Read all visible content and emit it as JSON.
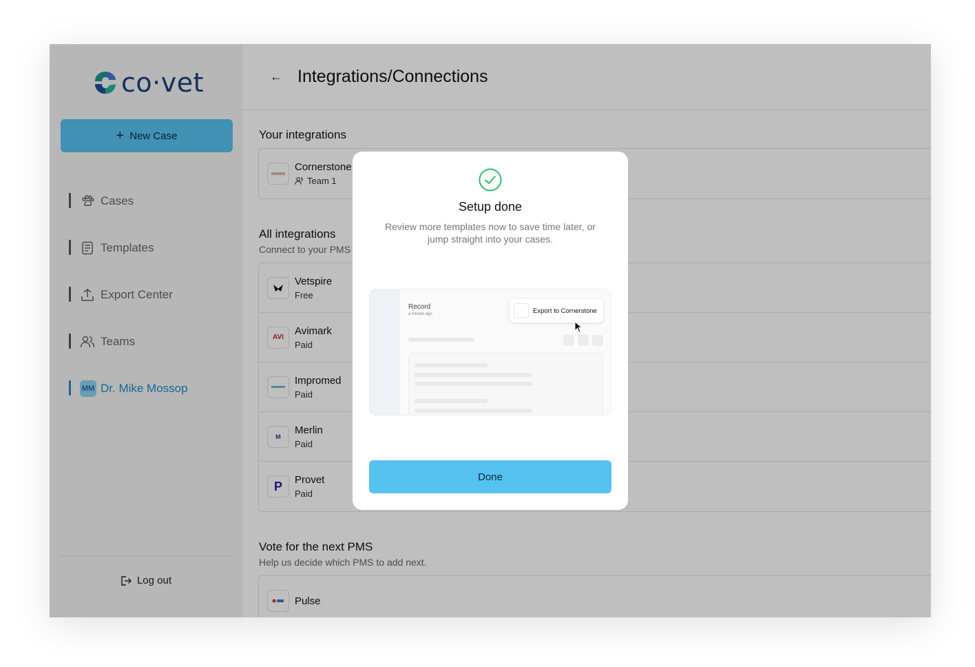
{
  "brand": {
    "name": "co·vet"
  },
  "sidebar": {
    "new_case_label": "New Case",
    "items": [
      {
        "label": "Cases",
        "icon": "paw-icon"
      },
      {
        "label": "Templates",
        "icon": "document-icon"
      },
      {
        "label": "Export Center",
        "icon": "upload-icon"
      },
      {
        "label": "Teams",
        "icon": "users-icon"
      },
      {
        "label": "Dr. Mike Mossop",
        "icon": "avatar",
        "initials": "MM",
        "active": true
      }
    ],
    "logout_label": "Log out"
  },
  "header": {
    "title": "Integrations/Connections"
  },
  "your_integrations": {
    "title": "Your integrations",
    "items": [
      {
        "name": "Cornerstone",
        "meta": "Team 1",
        "meta_icon": "users-icon"
      }
    ]
  },
  "all_integrations": {
    "title": "All integrations",
    "subtitle": "Connect to your PMS",
    "items": [
      {
        "name": "Vetspire",
        "meta": "Free",
        "logo_text": ""
      },
      {
        "name": "Avimark",
        "meta": "Paid",
        "logo_text": "AVI"
      },
      {
        "name": "Impromed",
        "meta": "Paid",
        "logo_text": ""
      },
      {
        "name": "Merlin",
        "meta": "Paid",
        "logo_text": "M"
      },
      {
        "name": "Provet",
        "meta": "Paid",
        "logo_text": "P"
      }
    ]
  },
  "vote": {
    "title": "Vote for the next PMS",
    "subtitle": "Help us decide which PMS to add next.",
    "items": [
      {
        "name": "Pulse"
      }
    ]
  },
  "modal": {
    "title": "Setup done",
    "subtitle": "Review more templates now to save time later, or jump straight into your cases.",
    "preview": {
      "record_label": "Record",
      "record_time": "a minute ago",
      "export_label": "Export to Cornerstone"
    },
    "done_label": "Done"
  },
  "colors": {
    "accent": "#56c2f0",
    "active_nav": "#1b8bc4",
    "success": "#2dbb6a"
  }
}
